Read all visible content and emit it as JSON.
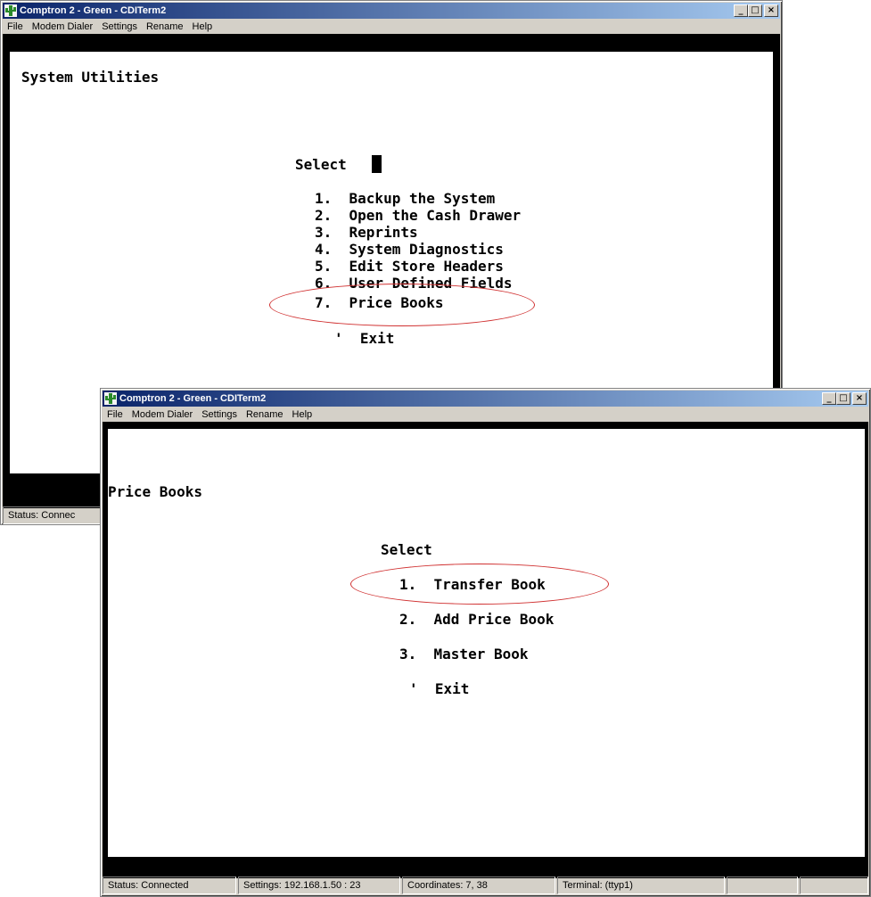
{
  "window1": {
    "title": "Comptron 2 - Green - CDITerm2",
    "menu": [
      "File",
      "Modem Dialer",
      "Settings",
      "Rename",
      "Help"
    ],
    "screen_title": "System Utilities",
    "select_label": "Select",
    "options": [
      "1.  Backup the System",
      "2.  Open the Cash Drawer",
      "3.  Reprints",
      "4.  System Diagnostics",
      "5.  Edit Store Headers",
      "6.  User Defined Fields",
      "7.  Price Books"
    ],
    "exit_label": "'  Exit",
    "status_partial": "Status: Connec"
  },
  "window2": {
    "title": "Comptron 2 - Green - CDITerm2",
    "menu": [
      "File",
      "Modem Dialer",
      "Settings",
      "Rename",
      "Help"
    ],
    "screen_title": "Price Books",
    "select_label": "Select",
    "options": [
      "1.  Transfer Book",
      "2.  Add Price Book",
      "3.  Master Book"
    ],
    "exit_label": "'  Exit",
    "status": {
      "status": "Status:  Connected",
      "settings": "Settings: 192.168.1.50 : 23",
      "coordinates": "Coordinates:    7, 38",
      "terminal": "Terminal: (ttyp1)"
    }
  },
  "colors": {
    "titlebar_start": "#0a246a",
    "titlebar_end": "#a6caf0",
    "highlight_ellipse": "#d03030",
    "chrome": "#d4d0c8"
  },
  "icons": [
    "cactus-app-icon",
    "minimize-icon",
    "maximize-icon",
    "close-icon"
  ]
}
